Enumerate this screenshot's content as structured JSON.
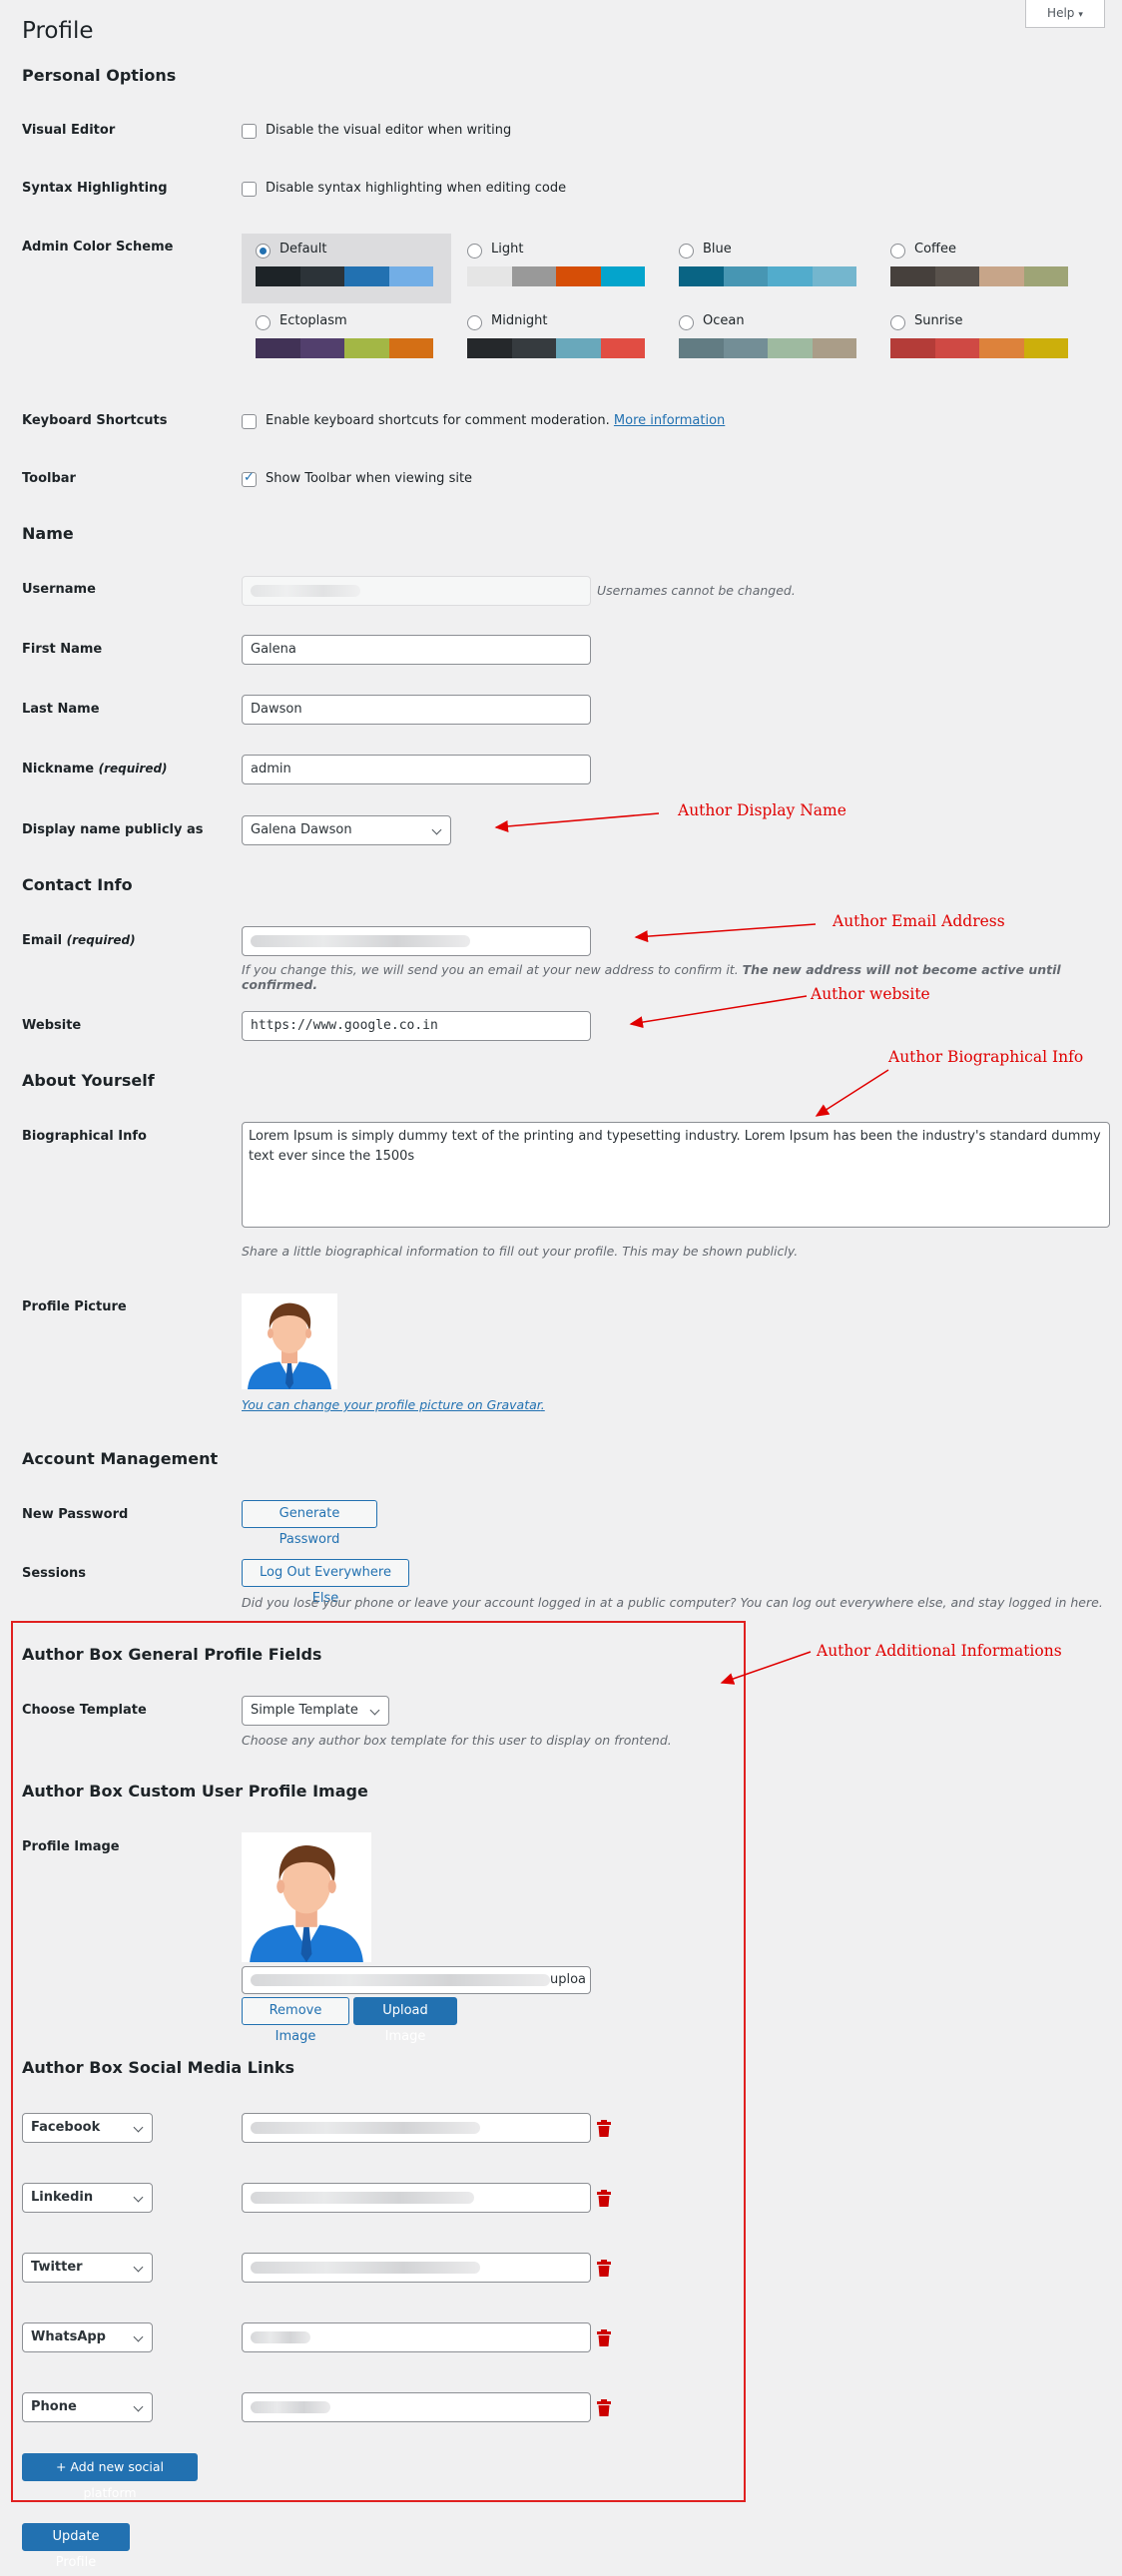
{
  "page": {
    "title": "Profile",
    "help_label": "Help"
  },
  "personal_options": {
    "heading": "Personal Options",
    "visual_editor": {
      "label": "Visual Editor",
      "checkbox_label": "Disable the visual editor when writing",
      "checked": false
    },
    "syntax_highlighting": {
      "label": "Syntax Highlighting",
      "checkbox_label": "Disable syntax highlighting when editing code",
      "checked": false
    },
    "admin_color_scheme": {
      "label": "Admin Color Scheme",
      "schemes": [
        {
          "name": "Default",
          "selected": true,
          "colors": [
            "#1d2327",
            "#2c3338",
            "#2271b1",
            "#72aee6"
          ]
        },
        {
          "name": "Light",
          "selected": false,
          "colors": [
            "#e5e5e5",
            "#999999",
            "#d64e07",
            "#04a4cc"
          ]
        },
        {
          "name": "Blue",
          "selected": false,
          "colors": [
            "#096484",
            "#4796b3",
            "#52accc",
            "#74b6ce"
          ]
        },
        {
          "name": "Coffee",
          "selected": false,
          "colors": [
            "#46403c",
            "#59524c",
            "#c7a589",
            "#9ea476"
          ]
        },
        {
          "name": "Ectoplasm",
          "selected": false,
          "colors": [
            "#413256",
            "#523f6d",
            "#a3b745",
            "#d46f15"
          ]
        },
        {
          "name": "Midnight",
          "selected": false,
          "colors": [
            "#25282b",
            "#363b3f",
            "#69a8bb",
            "#e14d43"
          ]
        },
        {
          "name": "Ocean",
          "selected": false,
          "colors": [
            "#627c83",
            "#738e96",
            "#9ebaa0",
            "#aa9d88"
          ]
        },
        {
          "name": "Sunrise",
          "selected": false,
          "colors": [
            "#b43c38",
            "#cf4944",
            "#dd823b",
            "#ccaf0b"
          ]
        }
      ]
    },
    "keyboard_shortcuts": {
      "label": "Keyboard Shortcuts",
      "checkbox_label": "Enable keyboard shortcuts for comment moderation.",
      "link": "More information",
      "checked": false
    },
    "toolbar": {
      "label": "Toolbar",
      "checkbox_label": "Show Toolbar when viewing site",
      "checked": true
    }
  },
  "name": {
    "heading": "Name",
    "username": {
      "label": "Username",
      "note": "Usernames cannot be changed."
    },
    "first_name": {
      "label": "First Name",
      "value": "Galena"
    },
    "last_name": {
      "label": "Last Name",
      "value": "Dawson"
    },
    "nickname": {
      "label": "Nickname",
      "required": "(required)",
      "value": "admin"
    },
    "display_name": {
      "label": "Display name publicly as",
      "value": "Galena Dawson"
    }
  },
  "contact": {
    "heading": "Contact Info",
    "email": {
      "label": "Email",
      "required": "(required)",
      "note_prefix": "If you change this, we will send you an email at your new address to confirm it.",
      "note_bold": "The new address will not become active until confirmed."
    },
    "website": {
      "label": "Website",
      "value": "https://www.google.co.in"
    }
  },
  "about": {
    "heading": "About Yourself",
    "bio": {
      "label": "Biographical Info",
      "value": "Lorem Ipsum is simply dummy text of the printing and typesetting industry. Lorem Ipsum has been the industry's standard dummy text ever since the 1500s",
      "note": "Share a little biographical information to fill out your profile. This may be shown publicly."
    },
    "picture": {
      "label": "Profile Picture",
      "link": "You can change your profile picture on Gravatar"
    }
  },
  "account": {
    "heading": "Account Management",
    "new_password": {
      "label": "New Password",
      "button": "Generate Password"
    },
    "sessions": {
      "label": "Sessions",
      "button": "Log Out Everywhere Else",
      "note": "Did you lose your phone or leave your account logged in at a public computer? You can log out everywhere else, and stay logged in here."
    }
  },
  "author_box": {
    "general_heading": "Author Box General Profile Fields",
    "template": {
      "label": "Choose Template",
      "value": "Simple Template",
      "note": "Choose any author box template for this user to display on frontend."
    },
    "image_heading": "Author Box Custom User Profile Image",
    "image": {
      "label": "Profile Image",
      "url_tail": "uploa",
      "remove_button": "Remove Image",
      "upload_button": "Upload Image"
    },
    "social_heading": "Author Box Social Media Links",
    "social": [
      {
        "platform": "Facebook"
      },
      {
        "platform": "Linkedin"
      },
      {
        "platform": "Twitter"
      },
      {
        "platform": "WhatsApp"
      },
      {
        "platform": "Phone"
      }
    ],
    "add_button": "+ Add new social platform"
  },
  "submit": {
    "label": "Update Profile"
  },
  "annotations": {
    "display_name": "Author Display Name",
    "email": "Author Email Address",
    "website": "Author website",
    "bio": "Author Biographical Info",
    "additional": "Author Additional Informations"
  },
  "colors": {
    "accent": "#2271b1",
    "annotation": "#e00000"
  }
}
